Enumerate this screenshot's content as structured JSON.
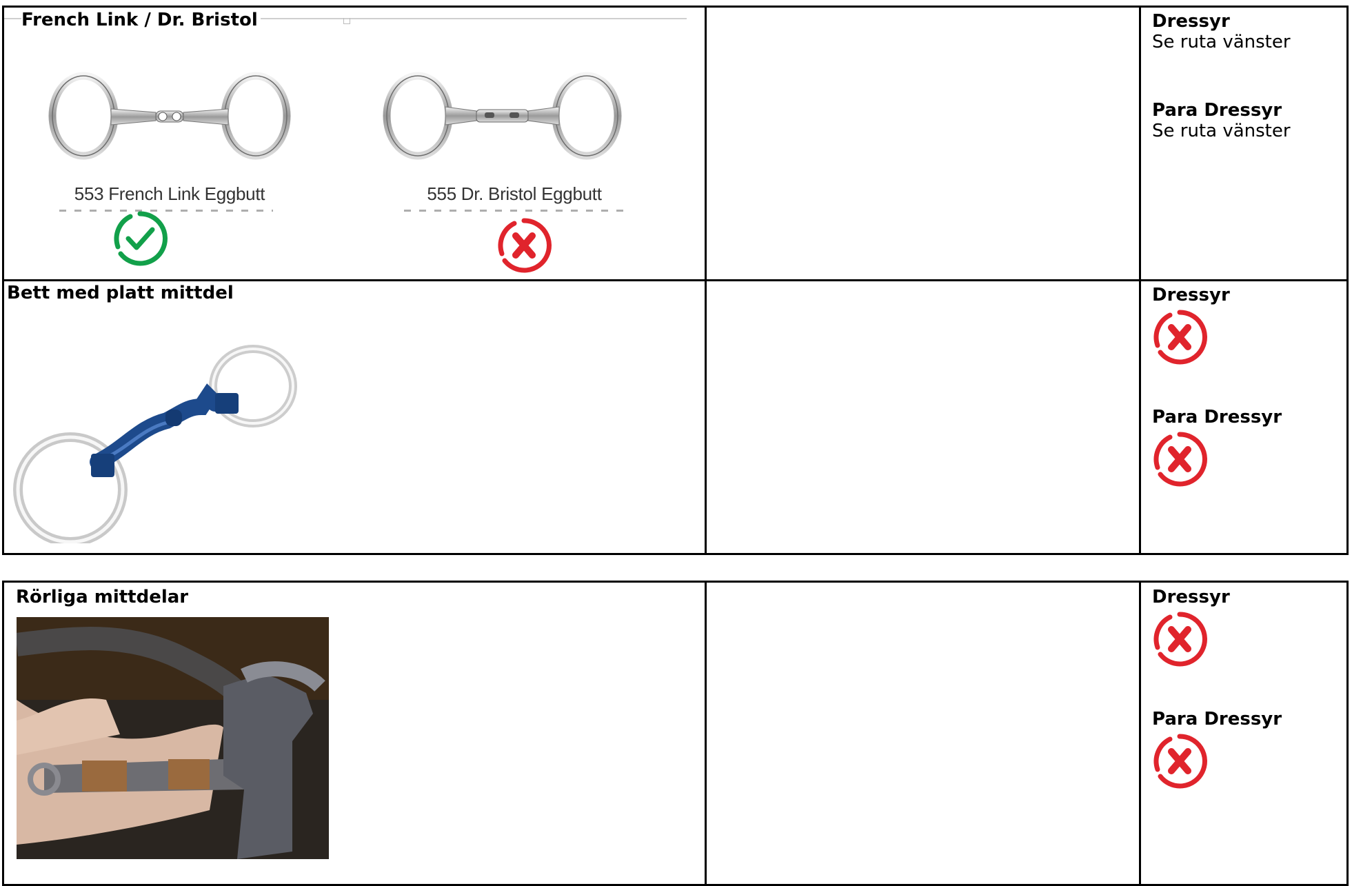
{
  "rows": [
    {
      "title": "French Link / Dr. Bristol",
      "images": [
        {
          "caption": "553 French Link Eggbutt",
          "status": "allowed",
          "icon": "check-circle-icon"
        },
        {
          "caption": "555 Dr. Bristol Eggbutt",
          "status": "not-allowed",
          "icon": "cross-circle-icon"
        }
      ],
      "rules": [
        {
          "heading": "Dressyr",
          "text": "Se ruta vänster"
        },
        {
          "heading": "Para Dressyr",
          "text": "Se ruta vänster"
        }
      ]
    },
    {
      "title": "Bett med platt mittdel",
      "images": [
        {
          "description_icon": "blue-bit-photo-icon"
        }
      ],
      "rules": [
        {
          "heading": "Dressyr",
          "status": "not-allowed",
          "icon": "cross-circle-icon"
        },
        {
          "heading": "Para Dressyr",
          "status": "not-allowed",
          "icon": "cross-circle-icon"
        }
      ]
    },
    {
      "title": "Rörliga mittdelar",
      "images": [
        {
          "description_icon": "rolling-bit-photo-icon"
        }
      ],
      "rules": [
        {
          "heading": "Dressyr",
          "status": "not-allowed",
          "icon": "cross-circle-icon"
        },
        {
          "heading": "Para Dressyr",
          "status": "not-allowed",
          "icon": "cross-circle-icon"
        }
      ]
    }
  ],
  "colors": {
    "check": "#12a04a",
    "cross": "#e0242c",
    "border": "#000000"
  }
}
